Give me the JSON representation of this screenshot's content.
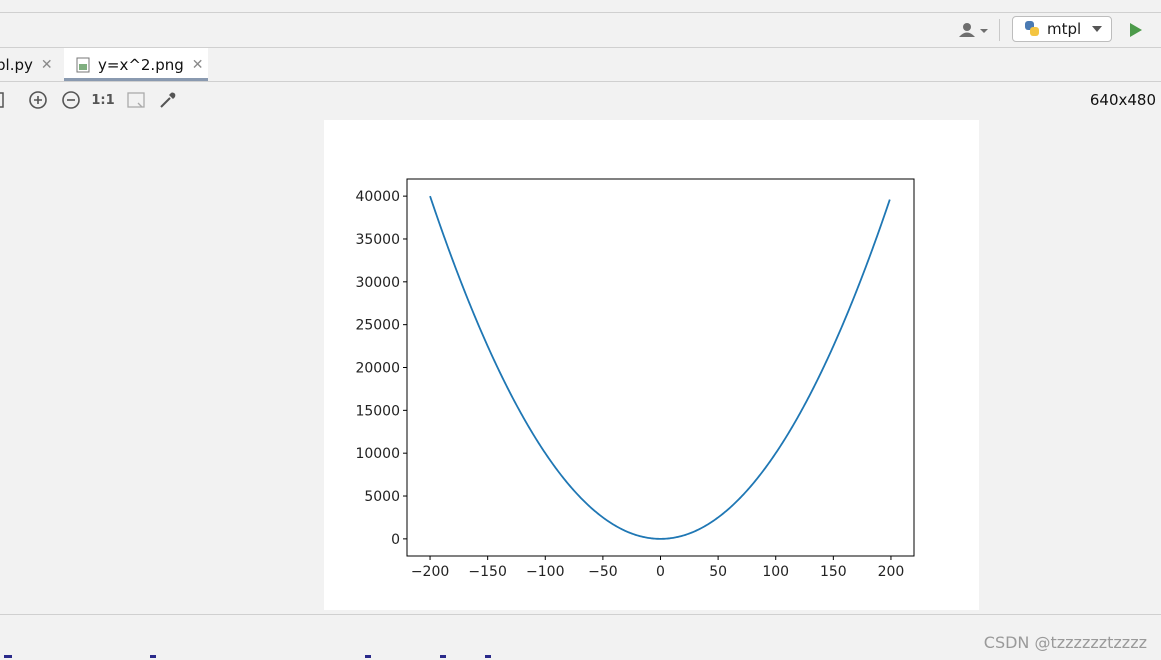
{
  "toolbar": {
    "run_config_label": "mtpl",
    "icons": [
      "user-icon",
      "python-icon",
      "run-icon"
    ]
  },
  "tabs": [
    {
      "label": "pl.py",
      "active": false
    },
    {
      "label": "y=x^2.png",
      "active": true
    }
  ],
  "image_toolbar": {
    "actual_size_label": "1:1",
    "dimensions": "640x480"
  },
  "chart_data": {
    "type": "line",
    "x_ticks": [
      -200,
      -150,
      -100,
      -50,
      0,
      50,
      100,
      150,
      200
    ],
    "y_ticks": [
      0,
      5000,
      10000,
      15000,
      20000,
      25000,
      30000,
      35000,
      40000
    ],
    "x_tick_labels": [
      "−200",
      "−150",
      "−100",
      "−50",
      "0",
      "50",
      "100",
      "150",
      "200"
    ],
    "y_tick_labels": [
      "0",
      "5000",
      "10000",
      "15000",
      "20000",
      "25000",
      "30000",
      "35000",
      "40000"
    ],
    "xlim": [
      -220,
      220
    ],
    "ylim": [
      -2000,
      42000
    ],
    "series": [
      {
        "function": "y = x^2",
        "x_start": -200,
        "x_end": 199,
        "color": "#1f77b4"
      }
    ],
    "grid": false,
    "title": "",
    "xlabel": "",
    "ylabel": ""
  },
  "watermark": "CSDN @tzzzzzztzzzz"
}
